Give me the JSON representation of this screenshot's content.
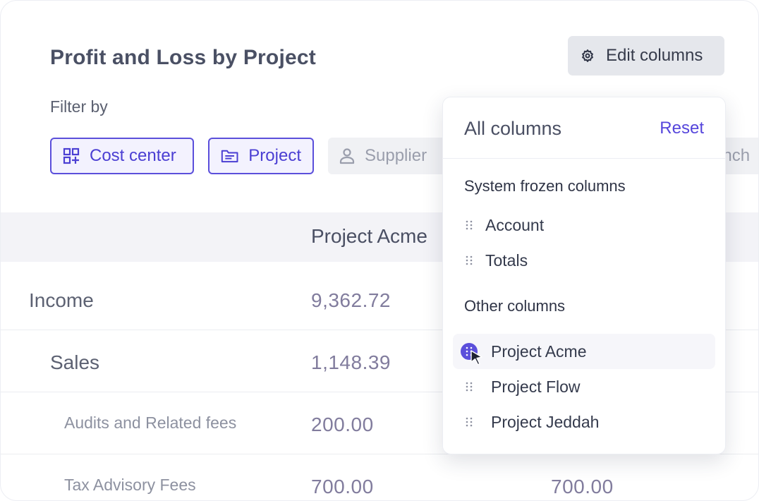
{
  "header": {
    "title": "Profit and Loss by Project",
    "edit_columns_label": "Edit columns"
  },
  "filters": {
    "label": "Filter by",
    "chips": [
      {
        "label": "Cost center",
        "active": true,
        "icon": "grid-plus-icon"
      },
      {
        "label": "Project",
        "active": true,
        "icon": "folder-icon"
      },
      {
        "label": "Supplier",
        "active": false,
        "icon": "user-icon"
      },
      {
        "label": "Branch",
        "active": false,
        "icon": "none"
      }
    ]
  },
  "table": {
    "column_header": "Project Acme",
    "rows": [
      {
        "label": "Income",
        "value": "9,362.72"
      },
      {
        "label": "Sales",
        "value": "1,148.39"
      },
      {
        "label": "Audits and Related fees",
        "value": "200.00"
      },
      {
        "label": "Tax Advisory Fees",
        "value": "700.00",
        "value2": "700.00"
      }
    ]
  },
  "columns_popover": {
    "title": "All columns",
    "reset_label": "Reset",
    "frozen_section": "System frozen columns",
    "frozen_items": [
      "Account",
      "Totals"
    ],
    "other_section": "Other columns",
    "other_items": [
      "Project Acme",
      "Project Flow",
      "Project Jeddah"
    ]
  },
  "colors": {
    "accent": "#5b4fdb",
    "chip_active_bg": "#f3f2fe",
    "value_text": "#817c9d"
  }
}
